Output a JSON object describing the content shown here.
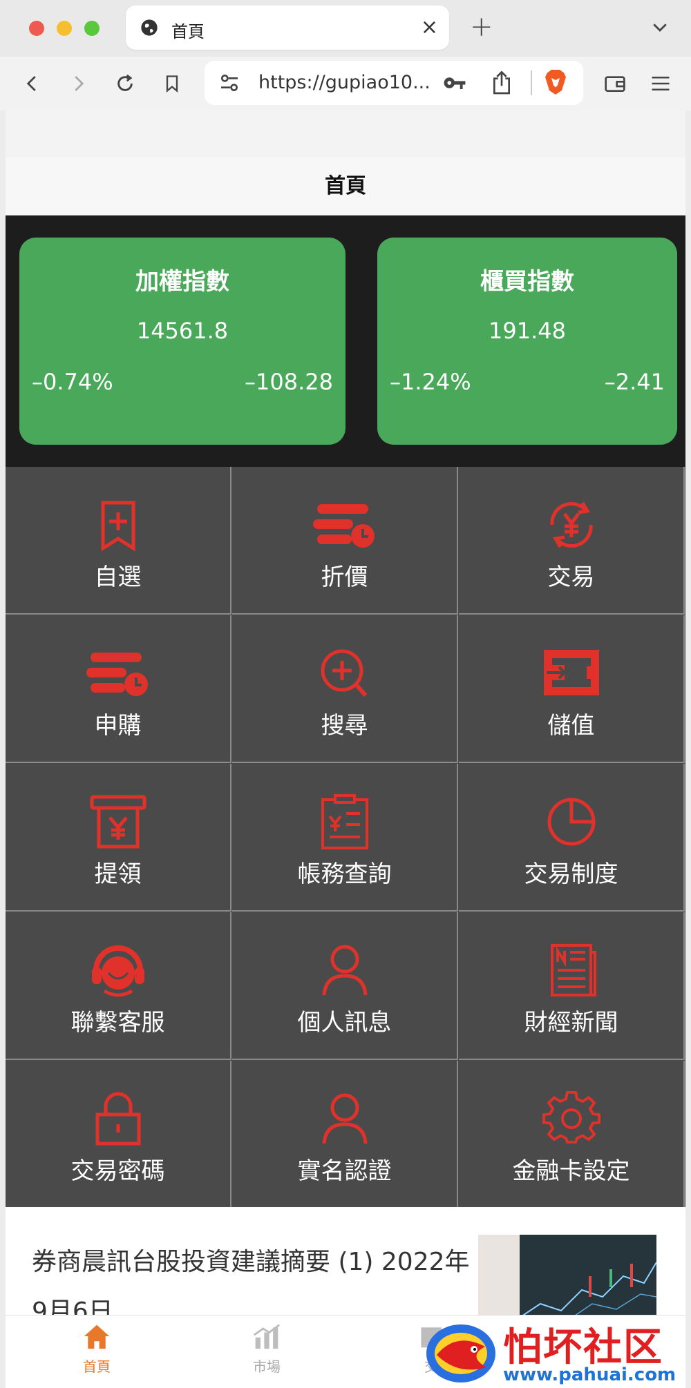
{
  "browser": {
    "tab_title": "首頁",
    "url": "https://gupiao10..."
  },
  "page": {
    "title": "首頁"
  },
  "indices": [
    {
      "name": "加權指數",
      "value": "14561.8",
      "pct": "–0.74%",
      "change": "–108.28"
    },
    {
      "name": "櫃買指數",
      "value": "191.48",
      "pct": "–1.24%",
      "change": "–2.41"
    }
  ],
  "menu": [
    {
      "label": "自選",
      "icon": "bookmark-plus-icon"
    },
    {
      "label": "折價",
      "icon": "discount-stack-icon"
    },
    {
      "label": "交易",
      "icon": "yen-exchange-icon"
    },
    {
      "label": "申購",
      "icon": "subscribe-stack-icon"
    },
    {
      "label": "搜尋",
      "icon": "search-plus-icon"
    },
    {
      "label": "儲值",
      "icon": "wallet-deposit-icon"
    },
    {
      "label": "提領",
      "icon": "atm-withdraw-icon"
    },
    {
      "label": "帳務查詢",
      "icon": "clipboard-yen-icon"
    },
    {
      "label": "交易制度",
      "icon": "pie-chart-icon"
    },
    {
      "label": "聯繫客服",
      "icon": "headset-support-icon"
    },
    {
      "label": "個人訊息",
      "icon": "user-icon"
    },
    {
      "label": "財經新聞",
      "icon": "newspaper-icon"
    },
    {
      "label": "交易密碼",
      "icon": "lock-icon"
    },
    {
      "label": "實名認證",
      "icon": "user-verify-icon"
    },
    {
      "label": "金融卡設定",
      "icon": "gear-icon"
    }
  ],
  "news": {
    "title": "券商晨訊台股投資建議摘要 (1) 2022年9月6日"
  },
  "bottom_nav": [
    {
      "label": "首頁",
      "icon": "home-icon",
      "active": true
    },
    {
      "label": "市場",
      "icon": "market-chart-icon",
      "active": false
    },
    {
      "label": "交",
      "icon": "trade-icon",
      "active": false
    }
  ],
  "watermark": {
    "text": "怕坏社区",
    "url": "www.pahuai.com"
  },
  "colors": {
    "accent_red": "#e0322a",
    "index_green": "#4aa85a",
    "grid_bg": "#4a4a4a",
    "nav_active": "#e8782a"
  }
}
